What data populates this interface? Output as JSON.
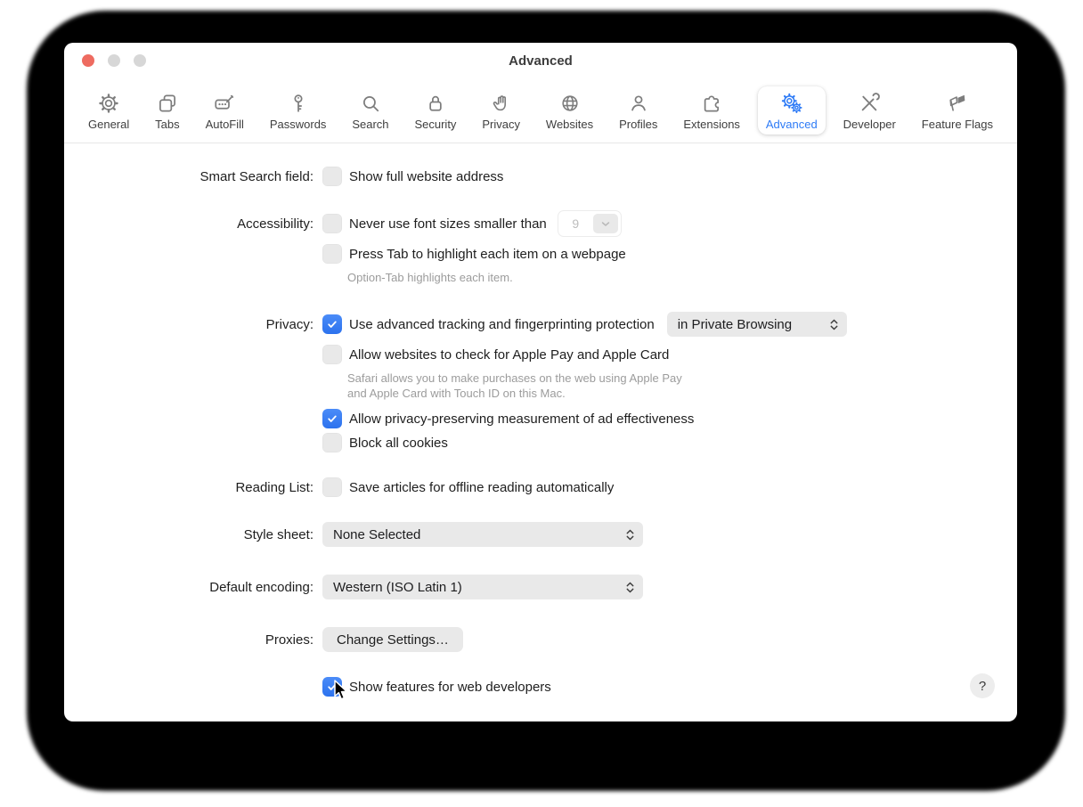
{
  "window": {
    "title": "Advanced"
  },
  "colors": {
    "accent_blue": "#2E7BF6",
    "traffic_red": "#EE6B60",
    "traffic_gray": "#D7D7D7",
    "control_gray": "#E9E9E9"
  },
  "toolbar": {
    "items": [
      {
        "label": "General",
        "icon": "gear-icon",
        "selected": false
      },
      {
        "label": "Tabs",
        "icon": "tabs-icon",
        "selected": false
      },
      {
        "label": "AutoFill",
        "icon": "autofill-icon",
        "selected": false
      },
      {
        "label": "Passwords",
        "icon": "key-icon",
        "selected": false
      },
      {
        "label": "Search",
        "icon": "magnifier-icon",
        "selected": false
      },
      {
        "label": "Security",
        "icon": "lock-icon",
        "selected": false
      },
      {
        "label": "Privacy",
        "icon": "hand-icon",
        "selected": false
      },
      {
        "label": "Websites",
        "icon": "globe-icon",
        "selected": false
      },
      {
        "label": "Profiles",
        "icon": "person-icon",
        "selected": false
      },
      {
        "label": "Extensions",
        "icon": "puzzle-icon",
        "selected": false
      },
      {
        "label": "Advanced",
        "icon": "gears-icon",
        "selected": true
      },
      {
        "label": "Developer",
        "icon": "tools-icon",
        "selected": false
      },
      {
        "label": "Feature Flags",
        "icon": "flags-icon",
        "selected": false
      }
    ]
  },
  "content": {
    "smart_search": {
      "label": "Smart Search field:",
      "checkbox_label": "Show full website address",
      "checked": false
    },
    "accessibility": {
      "label": "Accessibility:",
      "never_use_label": "Never use font sizes smaller than",
      "never_use_checked": false,
      "font_size_value": "9",
      "press_tab_label": "Press Tab to highlight each item on a webpage",
      "press_tab_checked": false,
      "press_tab_note": "Option-Tab highlights each item."
    },
    "privacy": {
      "label": "Privacy:",
      "tracking_label": "Use advanced tracking and fingerprinting protection",
      "tracking_checked": true,
      "tracking_scope_value": "in Private Browsing",
      "apple_pay_label": "Allow websites to check for Apple Pay and Apple Card",
      "apple_pay_checked": false,
      "apple_pay_note_line1": "Safari allows you to make purchases on the web using Apple Pay",
      "apple_pay_note_line2": "and Apple Card with Touch ID on this Mac.",
      "ad_measurement_label": "Allow privacy-preserving measurement of ad effectiveness",
      "ad_measurement_checked": true,
      "block_cookies_label": "Block all cookies",
      "block_cookies_checked": false
    },
    "reading_list": {
      "label": "Reading List:",
      "checkbox_label": "Save articles for offline reading automatically",
      "checked": false
    },
    "style_sheet": {
      "label": "Style sheet:",
      "value": "None Selected"
    },
    "default_encoding": {
      "label": "Default encoding:",
      "value": "Western (ISO Latin 1)"
    },
    "proxies": {
      "label": "Proxies:",
      "button_label": "Change Settings…"
    },
    "developer": {
      "checkbox_label": "Show features for web developers",
      "checked": true
    },
    "help": {
      "label": "?"
    }
  }
}
